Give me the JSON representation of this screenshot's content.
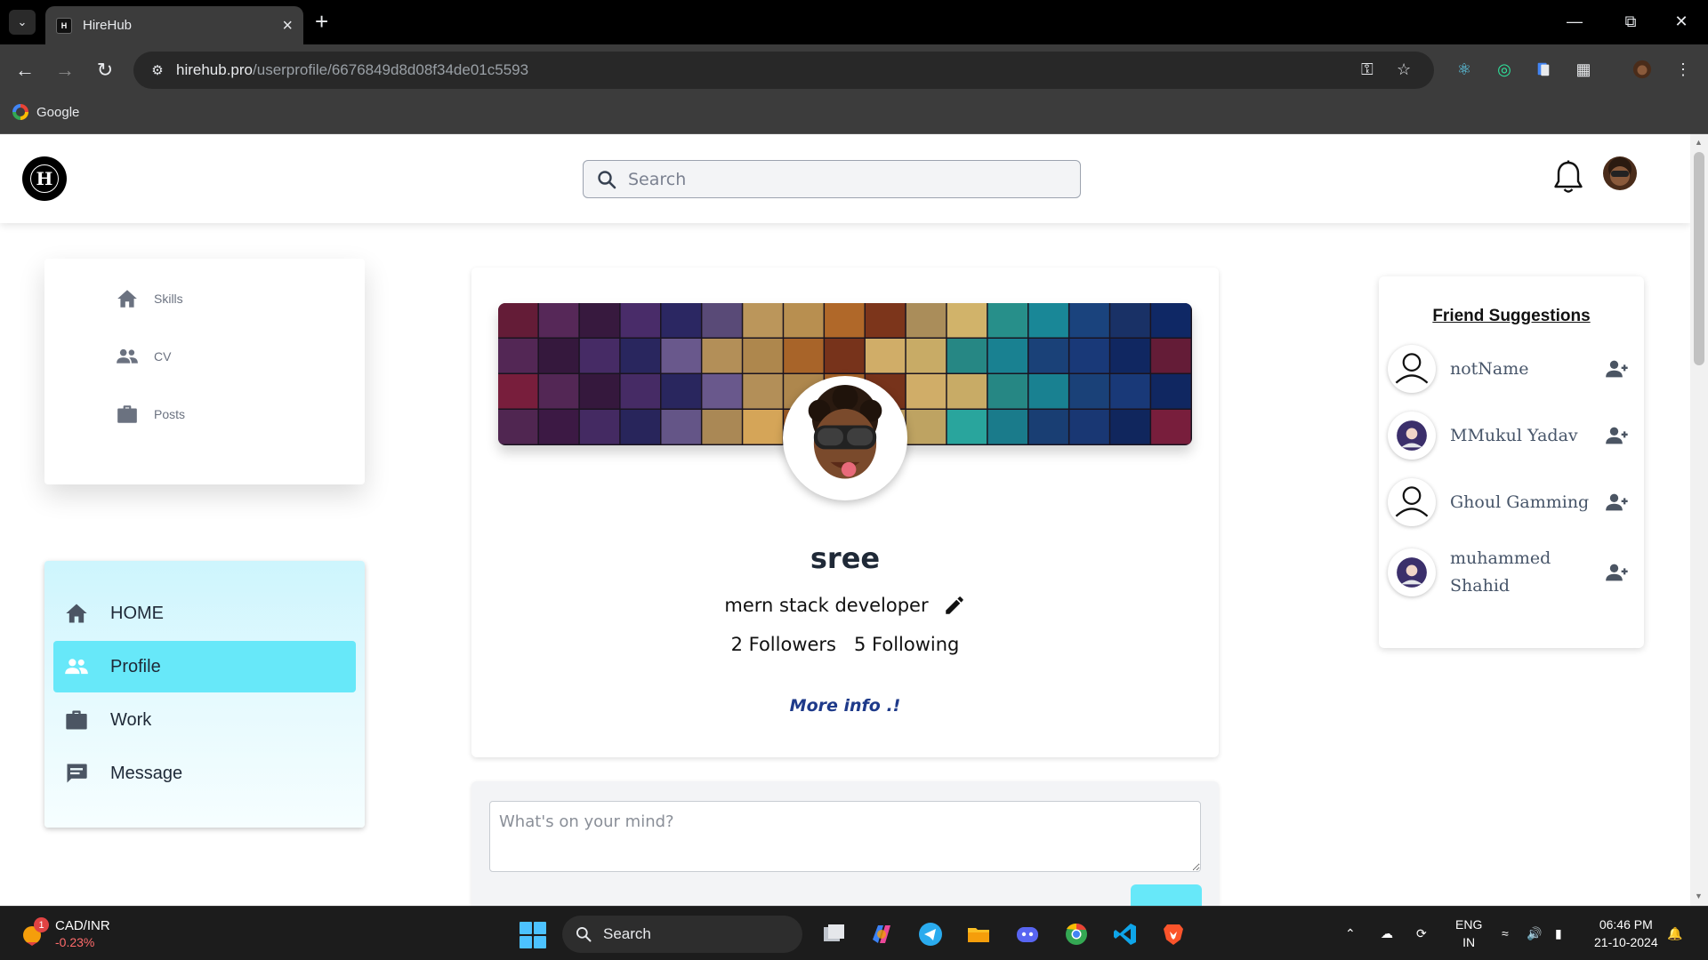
{
  "browser": {
    "tab_title": "HireHub",
    "tab_favicon_text": "H",
    "url_host": "hirehub.pro",
    "url_path": "/userprofile/6676849d8d08f34de01c5593",
    "bookmark_google": "Google"
  },
  "header": {
    "logo_text": "H",
    "search_placeholder": "Search"
  },
  "skills_card": {
    "items": [
      {
        "label": "Skills",
        "icon": "home-icon"
      },
      {
        "label": "CV",
        "icon": "people-icon"
      },
      {
        "label": "Posts",
        "icon": "briefcase-icon"
      }
    ]
  },
  "sidebar": {
    "items": [
      {
        "label": "HOME",
        "icon": "home-icon",
        "active": false
      },
      {
        "label": "Profile",
        "icon": "people-icon",
        "active": true
      },
      {
        "label": "Work",
        "icon": "briefcase-icon",
        "active": false
      },
      {
        "label": "Message",
        "icon": "message-icon",
        "active": false
      }
    ],
    "active_color": "#67e8f9"
  },
  "profile": {
    "username": "sree",
    "bio": "mern stack developer",
    "followers_label": "2 Followers",
    "following_label": "5 Following",
    "more_info": "More info .!"
  },
  "composer": {
    "placeholder": "What's on your mind?"
  },
  "friends": {
    "title": "Friend Suggestions",
    "items": [
      {
        "name": "notName",
        "avatar": "default-user-icon"
      },
      {
        "name": "MMukul Yadav",
        "avatar": "user-photo"
      },
      {
        "name": "Ghoul Gamming",
        "avatar": "default-user-icon"
      },
      {
        "name": "muhammed Shahid",
        "avatar": "user-photo"
      }
    ]
  },
  "taskbar": {
    "weather_badge": "1",
    "ticker_name": "CAD/INR",
    "ticker_change": "-0.23%",
    "search_label": "Search",
    "lang_line1": "ENG",
    "lang_line2": "IN",
    "time": "06:46 PM",
    "date": "21-10-2024"
  },
  "colors": {
    "accent": "#67e8f9",
    "link": "#1e3a8a",
    "browser_dark": "#3c3c3c"
  }
}
